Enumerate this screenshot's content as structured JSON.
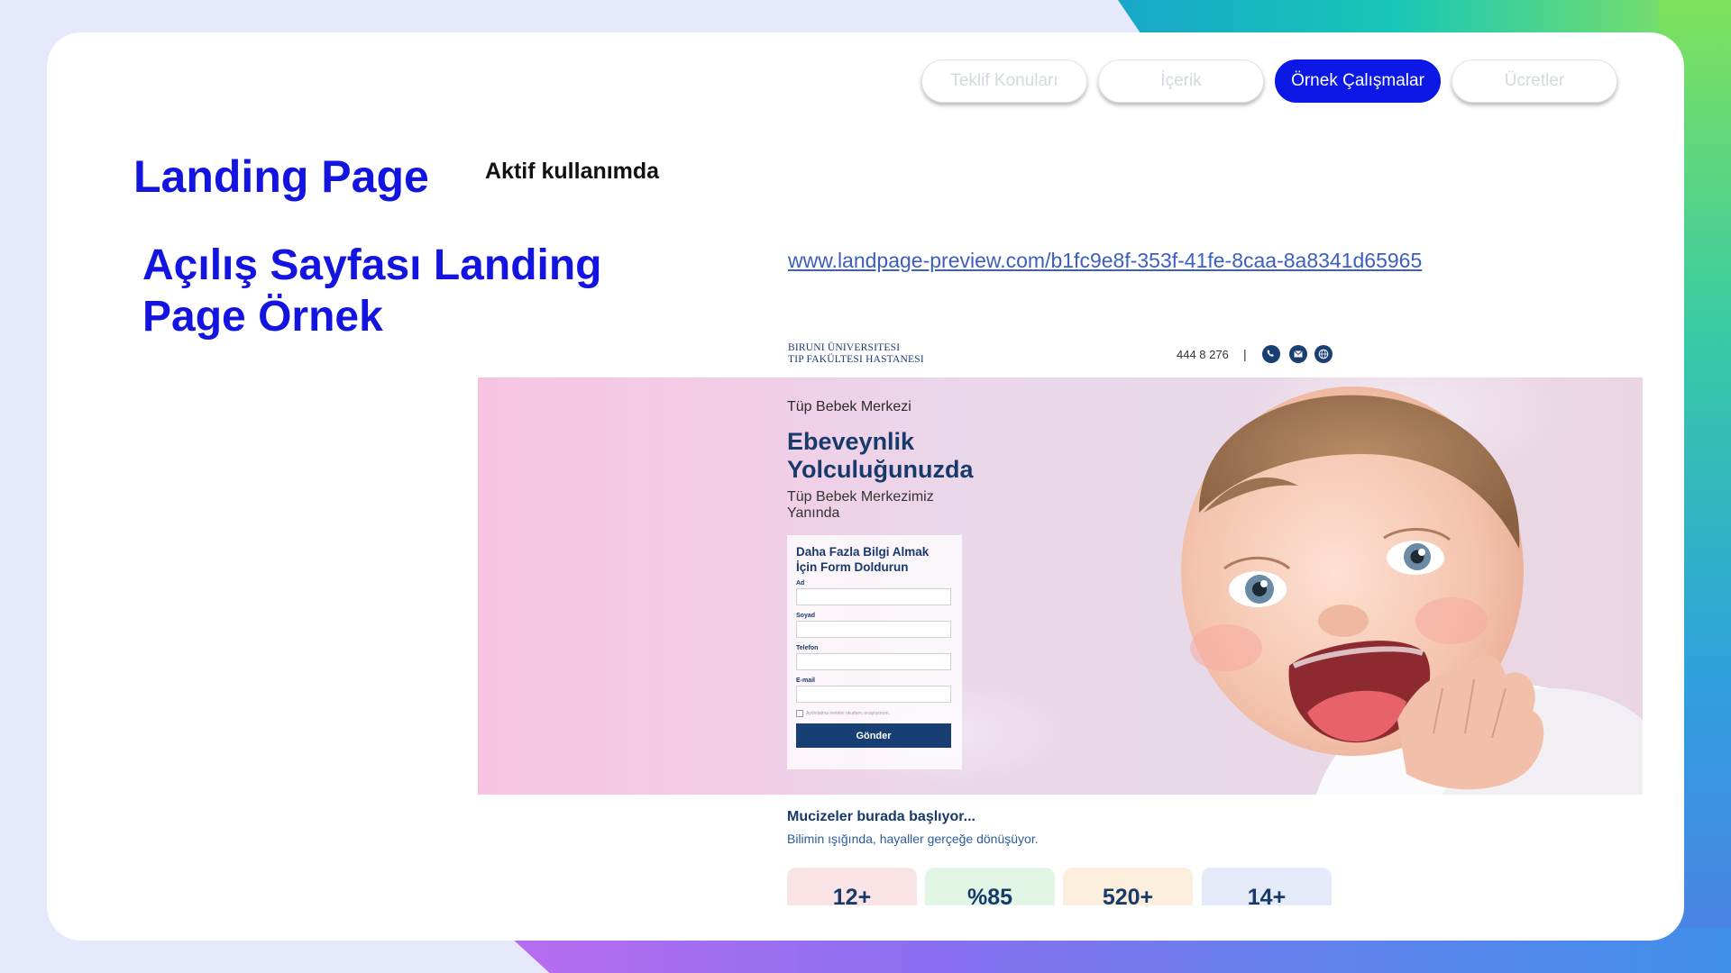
{
  "nav": {
    "tabs": [
      {
        "label": "Teklif Konuları",
        "active": false
      },
      {
        "label": "İçerik",
        "active": false
      },
      {
        "label": "Örnek Çalışmalar",
        "active": true
      },
      {
        "label": "Ücretler",
        "active": false
      }
    ]
  },
  "header": {
    "title": "Landing Page",
    "status": "Aktif kullanımda",
    "subtitle": "Açılış Sayfası Landing Page Örnek",
    "url": "www.landpage-preview.com/b1fc9e8f-353f-41fe-8caa-8a8341d65965"
  },
  "preview": {
    "logo_line1": "BIRUNI ÜNIVERSITESI",
    "logo_line2": "TIP FAKÜLTESI HASTANESI",
    "phone": "444 8 276",
    "separator": "|",
    "icons": [
      "phone-icon",
      "mail-icon",
      "globe-icon"
    ],
    "hero": {
      "eyebrow": "Tüp Bebek Merkezi",
      "title_line1": "Ebeveynlik",
      "title_line2": "Yolculuğunuzda",
      "subtitle": "Tüp Bebek Merkezimiz Yanında"
    },
    "form": {
      "title": "Daha Fazla Bilgi Almak İçin Form Doldurun",
      "fields": [
        "Ad",
        "Soyad",
        "Telefon",
        "E-mail"
      ],
      "consent": "Aydınlatma metnini okudum, onaylıyorum.",
      "submit": "Gönder"
    },
    "stats_heading": "Mucizeler burada başlıyor...",
    "stats_sub": "Bilimin ışığında, hayaller gerçeğe dönüşüyor.",
    "stats": [
      {
        "value": "12+",
        "color": "#f9e3e5"
      },
      {
        "value": "%85",
        "color": "#e2f6e6"
      },
      {
        "value": "520+",
        "color": "#fbeedd"
      },
      {
        "value": "14+",
        "color": "#e4eaf8"
      }
    ]
  },
  "colors": {
    "accent": "#1414e0",
    "active_tab": "#0b18e6",
    "preview_navy": "#173a6b"
  }
}
